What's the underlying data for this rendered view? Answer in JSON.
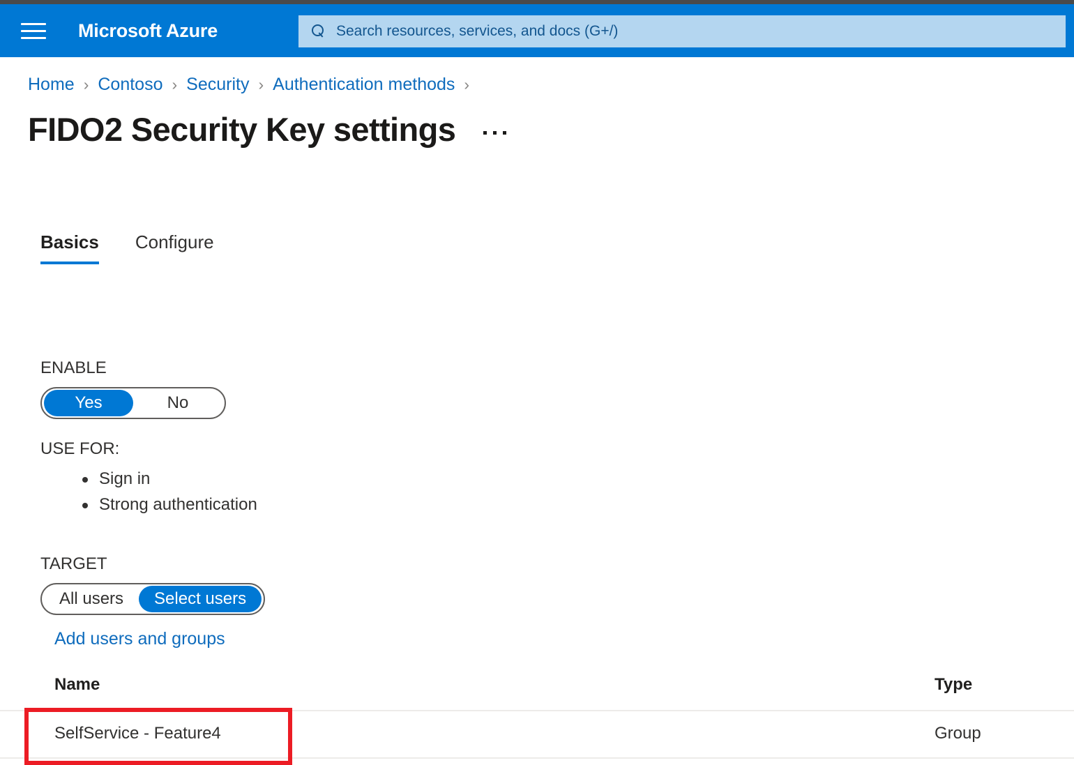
{
  "header": {
    "menu_icon": "hamburger-icon",
    "brand": "Microsoft Azure",
    "search": {
      "icon": "search-icon",
      "placeholder": "Search resources, services, and docs (G+/)"
    },
    "background_color": "#0078d4"
  },
  "breadcrumb": {
    "separator": "›",
    "items": [
      {
        "label": "Home"
      },
      {
        "label": "Contoso"
      },
      {
        "label": "Security"
      },
      {
        "label": "Authentication methods"
      }
    ]
  },
  "page": {
    "title": "FIDO2 Security Key settings",
    "more_menu_icon": "ellipsis-icon"
  },
  "tabs": [
    {
      "label": "Basics",
      "active": true
    },
    {
      "label": "Configure",
      "active": false
    }
  ],
  "enable": {
    "label": "ENABLE",
    "options": [
      {
        "label": "Yes",
        "selected": true
      },
      {
        "label": "No",
        "selected": false
      }
    ]
  },
  "use_for": {
    "label": "USE FOR:",
    "items": [
      {
        "label": "Sign in"
      },
      {
        "label": "Strong authentication"
      }
    ]
  },
  "target": {
    "label": "TARGET",
    "options": [
      {
        "label": "All users",
        "selected": false
      },
      {
        "label": "Select users",
        "selected": true
      }
    ],
    "add_link": "Add users and groups"
  },
  "table": {
    "columns": [
      {
        "key": "name",
        "label": "Name"
      },
      {
        "key": "type",
        "label": "Type"
      }
    ],
    "rows": [
      {
        "name": "SelfService - Feature4",
        "type": "Group"
      }
    ]
  },
  "annotation": {
    "highlight_color": "#ec1c24",
    "target": "SelfService - Feature4"
  },
  "colors": {
    "accent": "#0078d4",
    "link": "#0f6cbd",
    "search_field": "#b4d6f0",
    "top_strip": "#4a4a4a",
    "text": "#323130",
    "divider": "#edebe9"
  }
}
